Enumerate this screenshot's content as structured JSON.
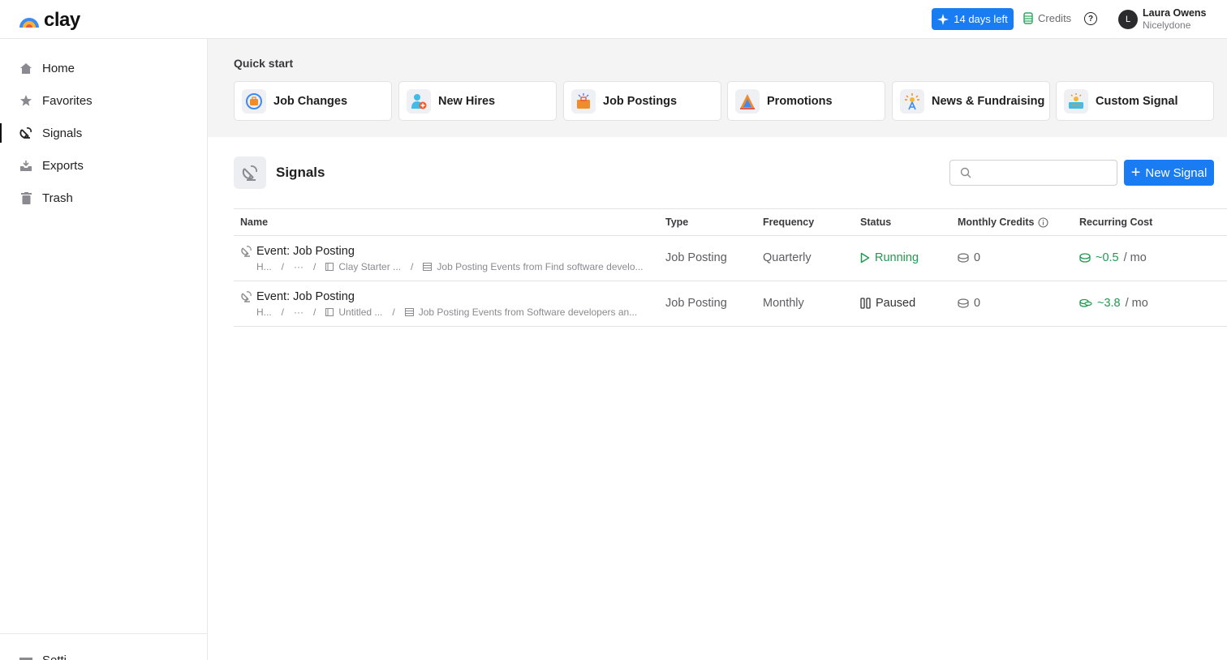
{
  "brand": {
    "name": "clay"
  },
  "topbar": {
    "trial_label": "14 days left",
    "credits_label": "Credits",
    "help_glyph": "?",
    "user": {
      "initial": "L",
      "name": "Laura Owens",
      "org": "Nicelydone"
    }
  },
  "sidebar": {
    "items": [
      {
        "label": "Home",
        "icon": "home-icon"
      },
      {
        "label": "Favorites",
        "icon": "star-icon"
      },
      {
        "label": "Signals",
        "icon": "signal-icon",
        "active": true
      },
      {
        "label": "Exports",
        "icon": "export-icon"
      },
      {
        "label": "Trash",
        "icon": "trash-icon"
      }
    ],
    "settings_label": "Setti"
  },
  "quickstart": {
    "title": "Quick start",
    "cards": [
      {
        "label": "Job Changes",
        "icon": "job-changes-icon"
      },
      {
        "label": "New Hires",
        "icon": "new-hires-icon"
      },
      {
        "label": "Job Postings",
        "icon": "job-postings-icon"
      },
      {
        "label": "Promotions",
        "icon": "promotions-icon"
      },
      {
        "label": "News & Fundraising",
        "icon": "news-icon"
      },
      {
        "label": "Custom Signal",
        "icon": "custom-signal-icon"
      }
    ]
  },
  "signals": {
    "title": "Signals",
    "search_placeholder": "",
    "new_button": "New Signal",
    "columns": [
      "Name",
      "Type",
      "Frequency",
      "Status",
      "Monthly Credits",
      "Recurring Cost"
    ],
    "rows": [
      {
        "name": "Event: Job Posting",
        "crumb1": "H...",
        "crumb2": "···",
        "crumb3": "Clay Starter ...",
        "crumb4": "Job Posting Events from Find software develo...",
        "type": "Job Posting",
        "frequency": "Quarterly",
        "status": "Running",
        "credits": "0",
        "cost": "~0.5",
        "cost_unit": "/ mo"
      },
      {
        "name": "Event: Job Posting",
        "crumb1": "H...",
        "crumb2": "···",
        "crumb3": "Untitled ...",
        "crumb4": "Job Posting Events from Software developers an...",
        "type": "Job Posting",
        "frequency": "Monthly",
        "status": "Paused",
        "credits": "0",
        "cost": "~3.8",
        "cost_unit": "/ mo"
      }
    ]
  },
  "colors": {
    "accent": "#1a7cf3",
    "running": "#1f9a4f"
  }
}
